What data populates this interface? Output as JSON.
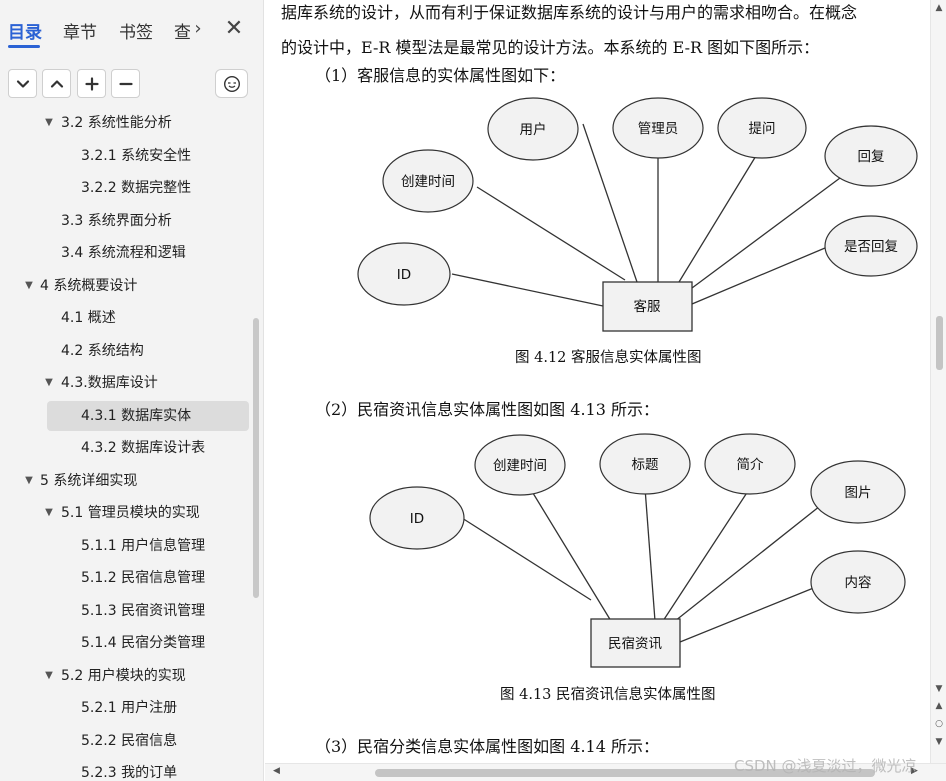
{
  "sidebar": {
    "tabs": [
      "目录",
      "章节",
      "书签",
      "查"
    ],
    "tab_more": "›",
    "tab_close": "✕",
    "toc": [
      {
        "label": "3.2 系统性能分析",
        "level": 1,
        "expanded": true
      },
      {
        "label": "3.2.1  系统安全性",
        "level": 2
      },
      {
        "label": "3.2.2  数据完整性",
        "level": 2
      },
      {
        "label": "3.3 系统界面分析",
        "level": 1
      },
      {
        "label": "3.4 系统流程和逻辑",
        "level": 1
      },
      {
        "label": "4 系统概要设计",
        "level": 0,
        "expanded": true
      },
      {
        "label": "4.1 概述",
        "level": 1
      },
      {
        "label": "4.2 系统结构",
        "level": 1
      },
      {
        "label": "4.3.数据库设计",
        "level": 1,
        "expanded": true
      },
      {
        "label": "4.3.1 数据库实体",
        "level": 2,
        "selected": true
      },
      {
        "label": "4.3.2 数据库设计表",
        "level": 2
      },
      {
        "label": "5 系统详细实现",
        "level": 0,
        "expanded": true
      },
      {
        "label": "5.1  管理员模块的实现",
        "level": 1,
        "expanded": true
      },
      {
        "label": "5.1.1  用户信息管理",
        "level": 2
      },
      {
        "label": "5.1.2  民宿信息管理",
        "level": 2
      },
      {
        "label": "5.1.3  民宿资讯管理",
        "level": 2
      },
      {
        "label": "5.1.4  民宿分类管理",
        "level": 2
      },
      {
        "label": "5.2  用户模块的实现",
        "level": 1,
        "expanded": true
      },
      {
        "label": "5.2.1  用户注册",
        "level": 2
      },
      {
        "label": "5.2.2  民宿信息",
        "level": 2
      },
      {
        "label": "5.2.3  我的订单",
        "level": 2
      }
    ]
  },
  "document": {
    "line1": "据库系统的设计，从而有利于保证数据库系统的设计与用户的需求相吻合。在概念",
    "line2": "的设计中，E-R 模型法是最常见的设计方法。本系统的 E-R 图如下图所示：",
    "section1": "（1）客服信息的实体属性图如下：",
    "caption1": "图 4.12   客服信息实体属性图",
    "section2": "（2）民宿资讯信息实体属性图如图 4.13 所示：",
    "caption2": "图 4.13   民宿资讯信息实体属性图",
    "section3": "（3）民宿分类信息实体属性图如图 4.14 所示：",
    "diagram1": {
      "entity": "客服",
      "attributes": [
        "用户",
        "管理员",
        "提问",
        "回复",
        "创建时间",
        "是否回复",
        "ID"
      ]
    },
    "diagram2": {
      "entity": "民宿资讯",
      "attributes": [
        "创建时间",
        "标题",
        "简介",
        "图片",
        "ID",
        "内容"
      ]
    }
  },
  "watermark": "CSDN @浅夏淡过，微光凉",
  "colors": {
    "accent": "#2b62d4",
    "sidebar_bg": "#f3f3f3",
    "selected_bg": "#dcdcdc",
    "ellipse_fill": "#f2f2f2"
  }
}
